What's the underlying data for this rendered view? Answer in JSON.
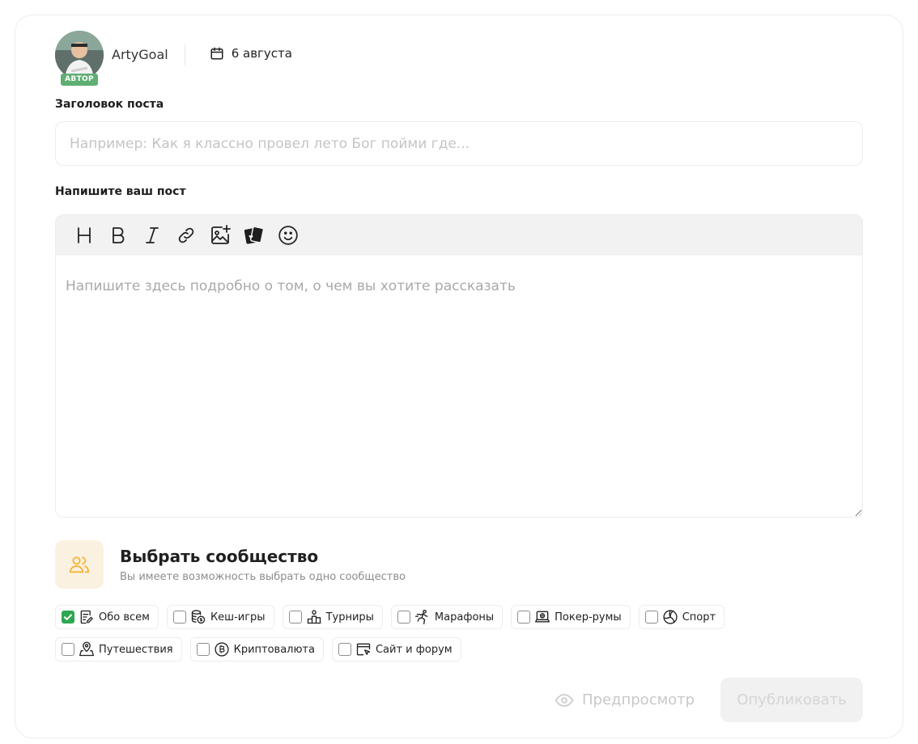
{
  "author": {
    "name": "ArtyGoal",
    "badge": "АВТОР",
    "date": "6 августа"
  },
  "post_title": {
    "label": "Заголовок поста",
    "placeholder": "Например: Как я классно провел лето Бог пойми где...",
    "value": ""
  },
  "post_body": {
    "label": "Напишите ваш пост",
    "placeholder": "Напишите здесь подробно о том, о чем вы хотите рассказать",
    "value": ""
  },
  "toolbar": {
    "icons": [
      "heading-icon",
      "bold-icon",
      "italic-icon",
      "link-icon",
      "image-add-icon",
      "cards-icon",
      "emoji-icon"
    ]
  },
  "community": {
    "title": "Выбрать сообщество",
    "subtitle": "Вы имеете возможность выбрать одно сообщество",
    "icon": "users-icon",
    "accent": "#f6b338",
    "options": [
      {
        "label": "Обо всем",
        "checked": true,
        "icon": "notes-edit-icon"
      },
      {
        "label": "Кеш-игры",
        "checked": false,
        "icon": "coins-dollar-icon"
      },
      {
        "label": "Турниры",
        "checked": false,
        "icon": "podium-icon"
      },
      {
        "label": "Марафоны",
        "checked": false,
        "icon": "runner-icon"
      },
      {
        "label": "Покер-румы",
        "checked": false,
        "icon": "laptop-poker-icon"
      },
      {
        "label": "Спорт",
        "checked": false,
        "icon": "volleyball-icon"
      },
      {
        "label": "Путешествия",
        "checked": false,
        "icon": "location-pin-icon"
      },
      {
        "label": "Криптовалюта",
        "checked": false,
        "icon": "bitcoin-icon"
      },
      {
        "label": "Сайт и форум",
        "checked": false,
        "icon": "browser-cursor-icon"
      }
    ]
  },
  "actions": {
    "preview": "Предпросмотр",
    "publish": "Опубликовать"
  },
  "colors": {
    "checkbox_checked": "#2ea84f",
    "badge": "#5fae73",
    "border": "#ececec"
  }
}
